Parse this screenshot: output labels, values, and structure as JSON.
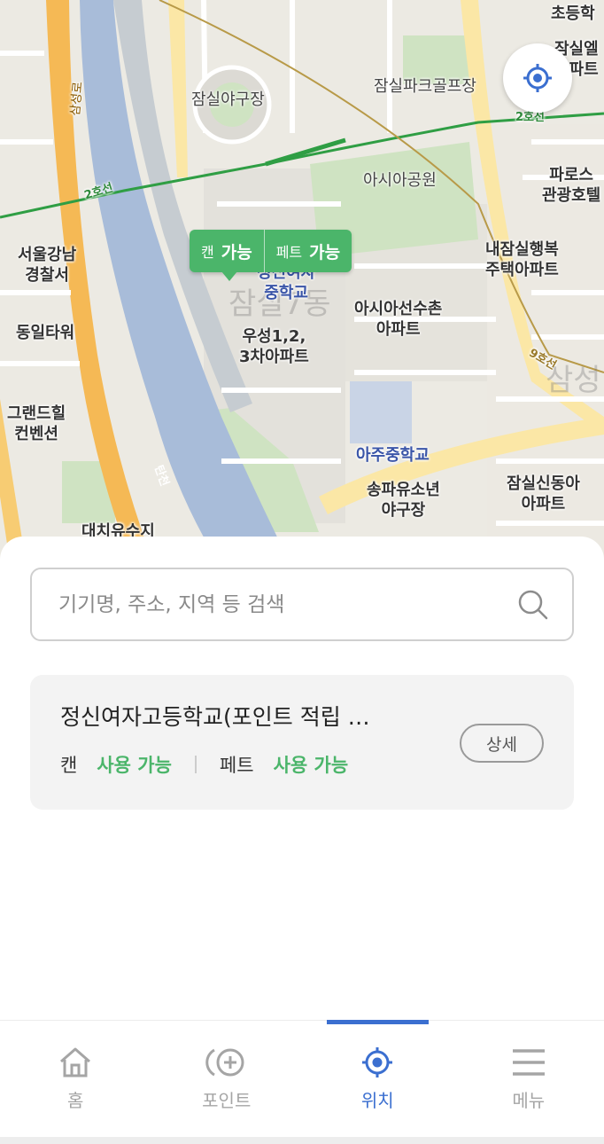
{
  "map": {
    "labels": {
      "stadium": "잠실야구장",
      "golf": "잠실파크골프장",
      "line2_left": "2호선",
      "line2_right": "2호선",
      "asia_park": "아시아공원",
      "police": "서울강남\n경찰서",
      "dongil": "동일타워",
      "grand": "그랜드힐\n컨벤션",
      "school_mid": "정신여자\n중학교",
      "apt_woosung": "우성1,2,\n3차아파트",
      "jamsil7": "잠실7동",
      "asia_village": "아시아선수촌\n아파트",
      "nae_jamsil": "내잠실행복\n주택아파트",
      "paros": "파로스\n관광호텔",
      "line9": "9호선",
      "samsung": "삼성",
      "ajoo": "아주중학교",
      "songpa": "송파유소년\n야구장",
      "jamsil_sindonga": "잠실신동아\n아파트",
      "daechi": "대치유수지",
      "river": "탄천",
      "top_right_school": "초등학",
      "jamsil_el": "잠실엘\n아파트",
      "samsung_road": "삼성로"
    },
    "marker": {
      "can_label": "캔",
      "can_status": "가능",
      "pet_label": "페트",
      "pet_status": "가능"
    },
    "locate_icon": "crosshair-icon"
  },
  "search": {
    "placeholder": "기기명, 주소, 지역 등 검색",
    "value": "",
    "icon": "search-icon"
  },
  "card": {
    "title": "정신여자고등학교(포인트 적립 …",
    "can_label": "캔",
    "can_status": "사용 가능",
    "pet_label": "페트",
    "pet_status": "사용 가능",
    "detail_label": "상세"
  },
  "tabs": [
    {
      "label": "홈",
      "icon": "home-icon",
      "active": false
    },
    {
      "label": "포인트",
      "icon": "point-icon",
      "active": false
    },
    {
      "label": "위치",
      "icon": "location-icon",
      "active": true
    },
    {
      "label": "메뉴",
      "icon": "menu-icon",
      "active": false
    }
  ],
  "colors": {
    "accent": "#3b6fd0",
    "available": "#4bb56a",
    "line2": "#2f9e44",
    "river": "#9fb6d6"
  }
}
